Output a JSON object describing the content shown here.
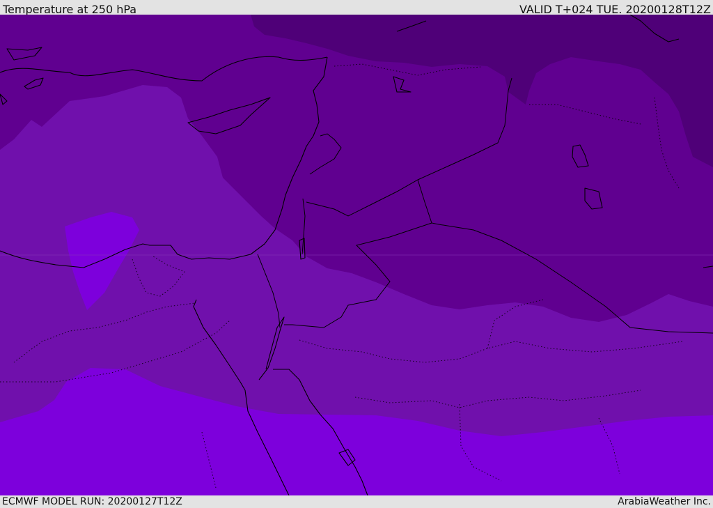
{
  "header": {
    "title": "Temperature at 250 hPa",
    "valid": "VALID T+024 TUE. 20200128T12Z"
  },
  "footer": {
    "model_run": "ECMWF MODEL RUN: 20200127T12Z",
    "credit": "ArabiaWeather Inc."
  },
  "map": {
    "field": "temperature",
    "level": "250 hPa",
    "colors": {
      "coldest": "#4f0078",
      "colder": "#600090",
      "cold": "#7010ac",
      "mild": "#7d00dc"
    }
  }
}
